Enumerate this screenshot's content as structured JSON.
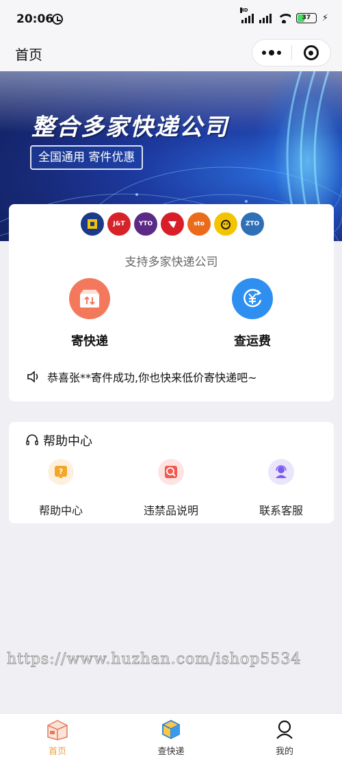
{
  "status_bar": {
    "time": "20:06",
    "battery": "37"
  },
  "nav": {
    "title": "首页"
  },
  "banner": {
    "title": "整合多家快递公司",
    "subtitle": "全国通用 寄件优惠"
  },
  "carriers": [
    {
      "icon": "carrier-logo-1",
      "label": "",
      "color": "#1b3a8c"
    },
    {
      "icon": "jt-logo",
      "label": "J&T",
      "color": "#d6232a"
    },
    {
      "icon": "yto-logo",
      "label": "YTO",
      "color": "#5a2a86"
    },
    {
      "icon": "carrier-logo-4",
      "label": "",
      "color": "#d81e28"
    },
    {
      "icon": "sto-logo",
      "label": "sto",
      "color": "#ec6b1a"
    },
    {
      "icon": "yunda-logo",
      "label": "",
      "color": "#f5c400"
    },
    {
      "icon": "zto-logo",
      "label": "ZTO",
      "color": "#2e6fb6"
    }
  ],
  "main": {
    "support_text": "支持多家快递公司",
    "send_label": "寄快递",
    "fee_label": "查运费",
    "notice": "恭喜张**寄件成功,你也快来低价寄快递吧~"
  },
  "help": {
    "title": "帮助中心",
    "items": [
      {
        "label": "帮助中心",
        "icon": "question-icon"
      },
      {
        "label": "违禁品说明",
        "icon": "prohibited-icon"
      },
      {
        "label": "联系客服",
        "icon": "service-icon"
      }
    ]
  },
  "watermark": "https://www.huzhan.com/ishop5534",
  "tabs": [
    {
      "label": "首页",
      "icon": "home-box-icon",
      "active": true
    },
    {
      "label": "查快递",
      "icon": "package-icon",
      "active": false
    },
    {
      "label": "我的",
      "icon": "user-icon",
      "active": false
    }
  ],
  "colors": {
    "accent": "#e8a24a",
    "send": "#f3785c",
    "fee": "#2f8ff0",
    "page_bg": "#efeff4"
  }
}
